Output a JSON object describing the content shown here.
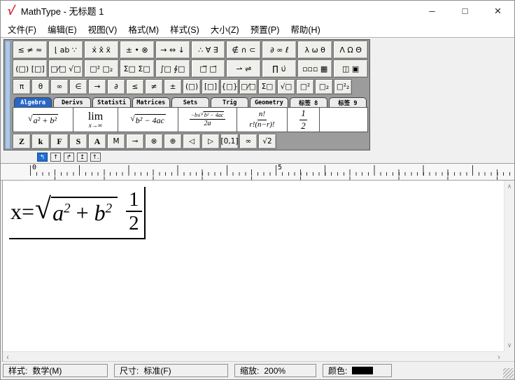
{
  "window": {
    "title": "MathType - 无标题 1",
    "logo": "√",
    "controls": {
      "minimize": "─",
      "maximize": "□",
      "close": "×"
    }
  },
  "menu": {
    "items": [
      "文件(F)",
      "编辑(E)",
      "视图(V)",
      "格式(M)",
      "样式(S)",
      "大小(Z)",
      "预置(P)",
      "帮助(H)"
    ]
  },
  "toolbar": {
    "row1": [
      "≤ ≠ ≈",
      "⌊ ab ∵",
      "x́ x̂ ẍ",
      "± • ⊗",
      "→ ⇔ ↓",
      "∴ ∀ ∃",
      "∉ ∩ ⊂",
      "∂ ∞ ℓ",
      "λ ω θ",
      "Λ Ω Θ"
    ],
    "row2": [
      "(□) [□]",
      "□⁄□ √□",
      "□² □₂",
      "Σ□ Σ□",
      "∫□ ∮□",
      "□̅ □⃗",
      "⇀ ⇌",
      "∏̇ ∪̇",
      "▫▫▫ ▦",
      "◫ ▣"
    ],
    "row3": [
      "π",
      "θ",
      "∞",
      "∈",
      "→",
      "∂",
      "≤",
      "≠",
      "±",
      "(□)",
      "[□]",
      "{□}",
      "□⁄□",
      "Σ□",
      "√□",
      "□²",
      "□₂",
      "□²₂"
    ],
    "tabs": [
      {
        "label": "Algebra",
        "active": true
      },
      {
        "label": "Derivs"
      },
      {
        "label": "Statisti"
      },
      {
        "label": "Matrices"
      },
      {
        "label": "Sets"
      },
      {
        "label": "Trig"
      },
      {
        "label": "Geometry"
      },
      {
        "label": "标签 8"
      },
      {
        "label": "标签 9"
      }
    ],
    "templates": [
      {
        "name": "sqrt-a2-plus-b2",
        "body": "a² + b²"
      },
      {
        "name": "limit",
        "op": "lim",
        "sub": "x→∞"
      },
      {
        "name": "sqrt-discriminant",
        "body": "b² − 4ac"
      },
      {
        "name": "quadratic-formula",
        "num_prefix": "−b±",
        "num_sqrt": "b² − 4ac",
        "den": "2a"
      },
      {
        "name": "combination",
        "num": "n!",
        "den": "r!(n−r)!"
      },
      {
        "name": "one-half",
        "num": "1",
        "den": "2"
      }
    ],
    "row4": [
      "Z",
      "k",
      "F",
      "S",
      "A",
      "M",
      "⊸",
      "⊗",
      "⊕",
      "◁",
      "▷",
      "[0,1]",
      "∞",
      "√2"
    ],
    "tabstops": [
      {
        "glyph": "↰",
        "active": true
      },
      {
        "glyph": "↑"
      },
      {
        "glyph": "↱"
      },
      {
        "glyph": "↥"
      },
      {
        "glyph": "↑."
      }
    ]
  },
  "ruler": {
    "marks": [
      "0",
      "5"
    ]
  },
  "equation": {
    "lhs": "x=",
    "sqrt": {
      "t1": "a",
      "e1": "2",
      "op": " + ",
      "t2": "b",
      "e2": "2"
    },
    "frac": {
      "num": "1",
      "den": "2"
    }
  },
  "scrollbar": {
    "up": "∧",
    "down": "∨",
    "left": "‹",
    "right": "›"
  },
  "status": {
    "style": {
      "label": "样式:",
      "value": "数学(M)"
    },
    "size": {
      "label": "尺寸:",
      "value": "标准(F)"
    },
    "zoom": {
      "label": "缩放:",
      "value": "200%"
    },
    "color": {
      "label": "颜色:",
      "swatch": "#000000"
    }
  }
}
